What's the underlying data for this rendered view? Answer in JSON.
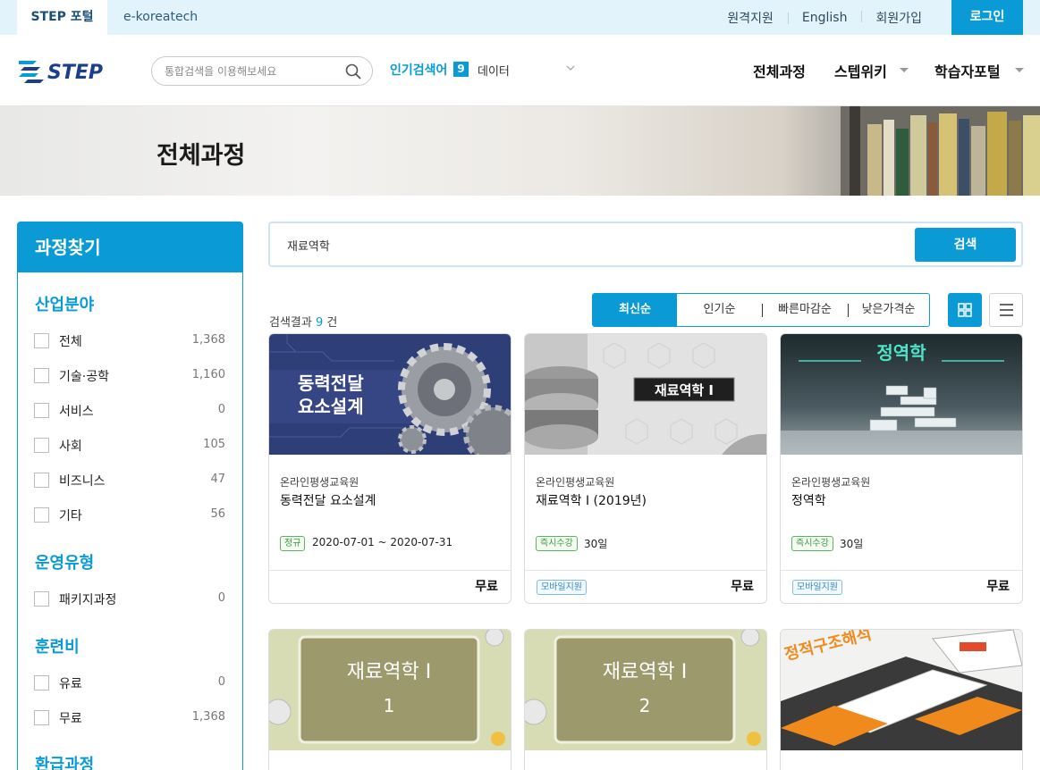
{
  "topbar": {
    "tab_step": "STEP 포털",
    "tab_ekt": "e-koreatech",
    "links": [
      "원격지원",
      "English",
      "회원가입"
    ],
    "login": "로그인"
  },
  "header": {
    "logo_text": "STEP",
    "search_placeholder": "통합검색을 이용해보세요",
    "popular_label": "인기검색어",
    "popular_rank": "9",
    "popular_word": "데이터",
    "nav": [
      "전체과정",
      "스텝위키",
      "학습자포털"
    ]
  },
  "banner": {
    "title": "전체과정"
  },
  "sidebar": {
    "title": "과정찾기",
    "sections": [
      {
        "title": "산업분야",
        "items": [
          {
            "label": "전체",
            "count": "1,368"
          },
          {
            "label": "기술·공학",
            "count": "1,160"
          },
          {
            "label": "서비스",
            "count": "0"
          },
          {
            "label": "사회",
            "count": "105"
          },
          {
            "label": "비즈니스",
            "count": "47"
          },
          {
            "label": "기타",
            "count": "56"
          }
        ]
      },
      {
        "title": "운영유형",
        "items": [
          {
            "label": "패키지과정",
            "count": "0"
          }
        ]
      },
      {
        "title": "훈련비",
        "items": [
          {
            "label": "유료",
            "count": "0"
          },
          {
            "label": "무료",
            "count": "1,368"
          }
        ]
      },
      {
        "title": "환급과정",
        "items": []
      }
    ]
  },
  "search": {
    "value": "재료역학",
    "button": "검색"
  },
  "result": {
    "label": "검색결과",
    "count": "9",
    "unit": "건"
  },
  "sort": [
    "최신순",
    "인기순",
    "빠른마감순",
    "낮은가격순"
  ],
  "cards": [
    {
      "thumb_text": [
        "동력전달",
        "요소설계"
      ],
      "org": "온라인평생교육원",
      "title": "동력전달 요소설계",
      "badge": "정규",
      "badge_value": "2020-07-01 ~ 2020-07-31",
      "mobile": "",
      "price": "무료"
    },
    {
      "thumb_text": [
        "재료역학 I"
      ],
      "org": "온라인평생교육원",
      "title": "재료역학 I (2019년)",
      "badge": "즉시수강",
      "badge_value": "30일",
      "mobile": "모바일지원",
      "price": "무료"
    },
    {
      "thumb_text": [
        "정역학"
      ],
      "org": "온라인평생교육원",
      "title": "정역학",
      "badge": "즉시수강",
      "badge_value": "30일",
      "mobile": "모바일지원",
      "price": "무료"
    },
    {
      "thumb_text": [
        "재료역학 I",
        "1"
      ]
    },
    {
      "thumb_text": [
        "재료역학 I",
        "2"
      ]
    },
    {
      "thumb_text": [
        "정적구조해석"
      ]
    }
  ],
  "colors": {
    "accent": "#0a9bd6",
    "topbar_bg": "#e2f3fb",
    "badge_green": "#3a9b3a"
  }
}
